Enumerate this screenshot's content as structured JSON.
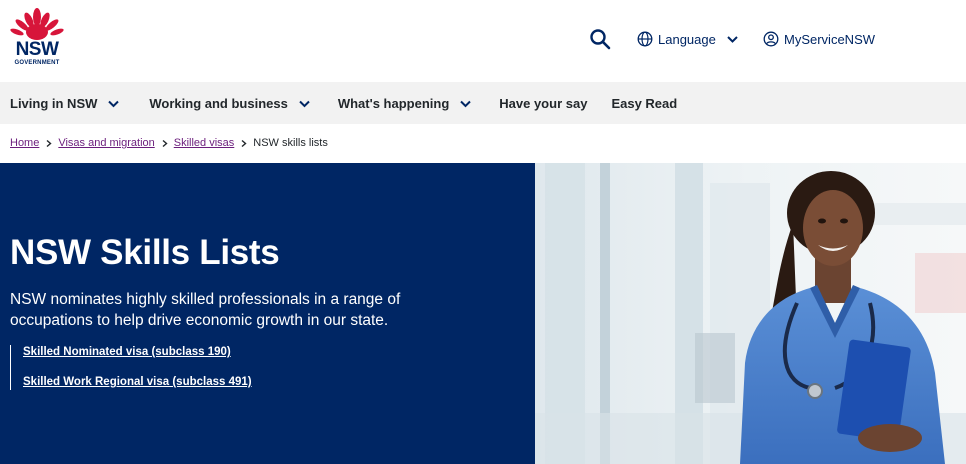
{
  "header": {
    "logo_text": "NSW",
    "logo_subtext": "GOVERNMENT",
    "search_icon": "search-icon",
    "language_label": "Language",
    "account_label": "MyServiceNSW"
  },
  "nav": {
    "items": [
      {
        "label": "Living in NSW",
        "has_dropdown": true
      },
      {
        "label": "Working and business",
        "has_dropdown": true
      },
      {
        "label": "What's happening",
        "has_dropdown": true
      },
      {
        "label": "Have your say",
        "has_dropdown": false
      },
      {
        "label": "Easy Read",
        "has_dropdown": false
      }
    ]
  },
  "breadcrumb": {
    "items": [
      "Home",
      "Visas and migration",
      "Skilled visas"
    ],
    "current": "NSW skills lists"
  },
  "hero": {
    "title": "NSW Skills Lists",
    "description": "NSW nominates highly skilled professionals in a range of occupations to help drive economic growth in our state.",
    "links": [
      "Skilled Nominated visa (subclass 190)",
      "Skilled Work Regional visa (subclass 491)"
    ]
  },
  "colors": {
    "brand_navy": "#002664",
    "nav_bg": "#f2f2f2",
    "waratah_red": "#d7153a",
    "visited_link": "#6b1d7c"
  }
}
